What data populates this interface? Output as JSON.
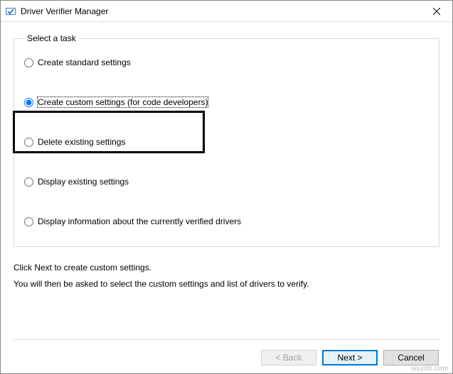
{
  "window": {
    "title": "Driver Verifier Manager"
  },
  "group": {
    "legend": "Select a task",
    "options": {
      "create_standard": "Create standard settings",
      "create_custom": "Create custom settings (for code developers)",
      "delete_existing": "Delete existing settings",
      "display_existing": "Display existing settings",
      "display_info": "Display information about the currently verified drivers"
    },
    "selected": "create_custom"
  },
  "instructions": {
    "line1": "Click Next to create custom settings.",
    "line2": "You will then be asked to select the custom settings and list of drivers to verify."
  },
  "buttons": {
    "back": "< Back",
    "next": "Next >",
    "cancel": "Cancel"
  },
  "watermark": "wsxdn.com"
}
